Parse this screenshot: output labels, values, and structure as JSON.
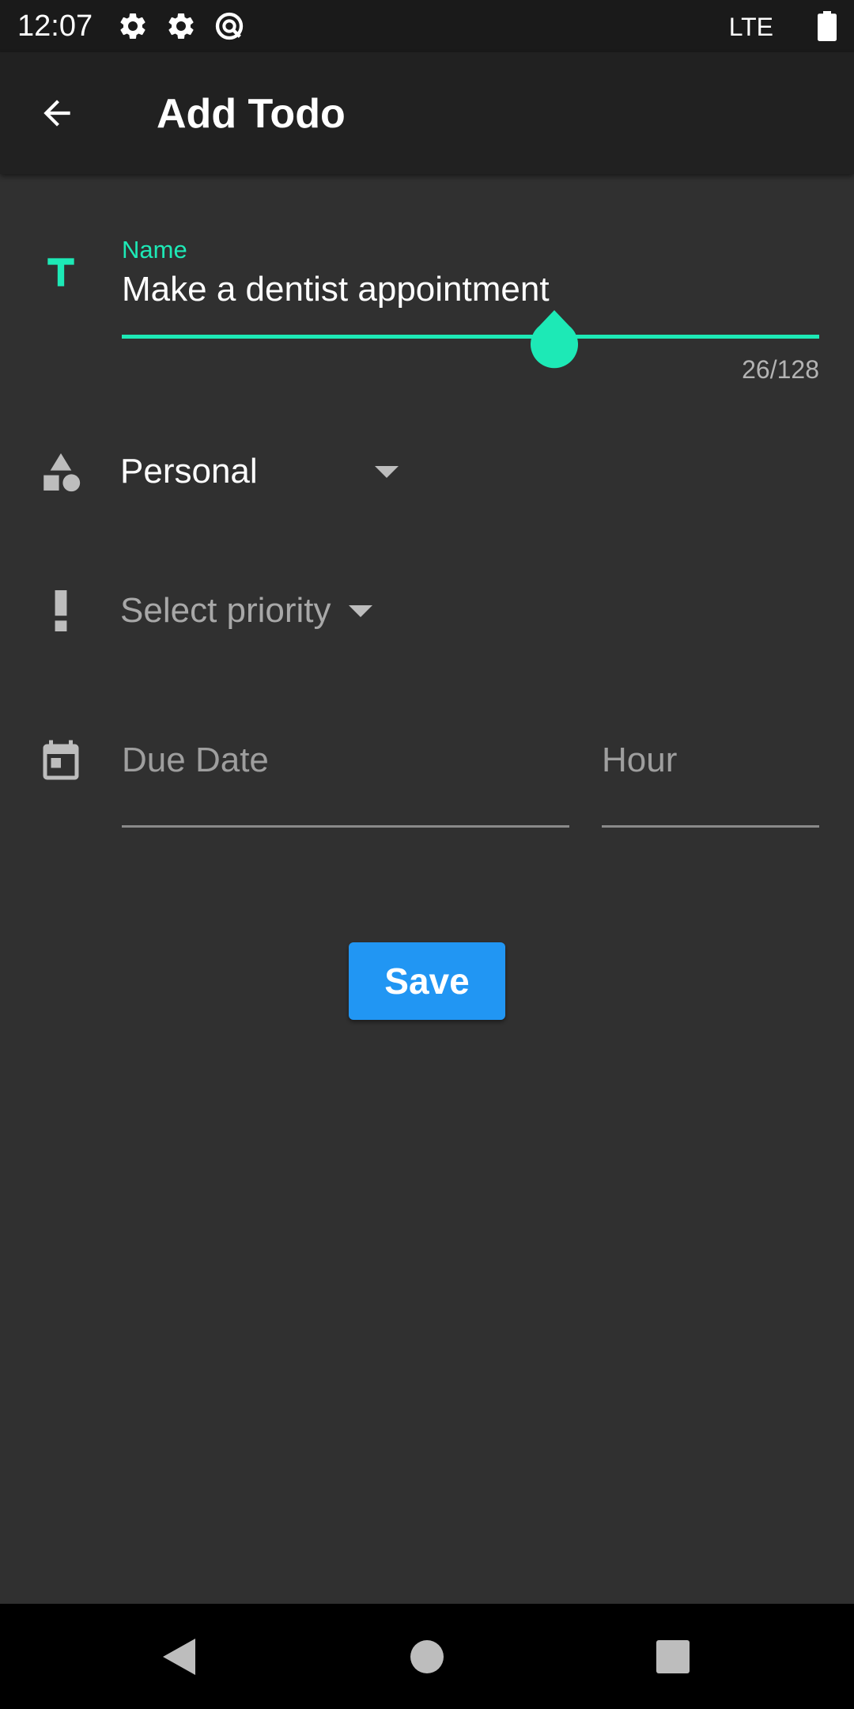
{
  "status_bar": {
    "time": "12:07",
    "network": "LTE",
    "icons": [
      "gear-icon",
      "gear-icon",
      "data-saver-icon",
      "battery-icon"
    ]
  },
  "app_bar": {
    "title": "Add Todo",
    "back_icon": "arrow-back-icon"
  },
  "form": {
    "name": {
      "label": "Name",
      "value": "Make a dentist appointment",
      "counter": "26/128",
      "icon": "title-t-icon"
    },
    "category": {
      "value": "Personal",
      "icon": "category-shapes-icon"
    },
    "priority": {
      "placeholder": "Select priority",
      "icon": "priority-exclamation-icon"
    },
    "due_date": {
      "placeholder": "Due Date",
      "icon": "calendar-icon"
    },
    "hour": {
      "placeholder": "Hour"
    },
    "save_label": "Save"
  },
  "nav_bar": {
    "buttons": [
      "back-triangle-icon",
      "home-circle-icon",
      "recents-square-icon"
    ]
  },
  "colors": {
    "background": "#303030",
    "app_bar": "#212121",
    "accent": "#1de9b6",
    "save_button": "#2196f3",
    "placeholder": "#9e9e9e"
  }
}
